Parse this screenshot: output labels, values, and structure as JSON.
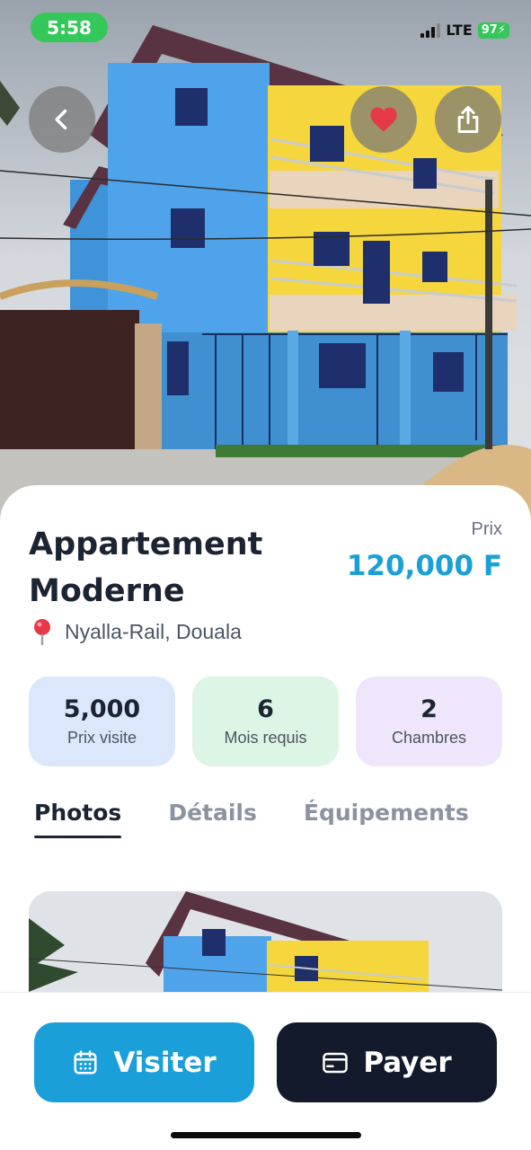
{
  "status_bar": {
    "time": "5:58",
    "network": "LTE",
    "battery": "97"
  },
  "hero": {
    "back_icon": "chevron-left-icon",
    "favorite_icon": "heart-icon",
    "share_icon": "share-icon",
    "favorite_color": "#e53945"
  },
  "listing": {
    "title_line1": "Appartement",
    "title_line2": "Moderne",
    "price_label": "Prix",
    "price_value": "120,000 F",
    "location_icon": "map-pin-icon",
    "location": "Nyalla-Rail, Douala"
  },
  "stats": [
    {
      "value": "5,000",
      "label": "Prix visite",
      "color": "#dbe8fb"
    },
    {
      "value": "6",
      "label": "Mois requis",
      "color": "#dcf5e4"
    },
    {
      "value": "2",
      "label": "Chambres",
      "color": "#efe6fb"
    }
  ],
  "tabs": [
    {
      "label": "Photos",
      "active": true
    },
    {
      "label": "Détails",
      "active": false
    },
    {
      "label": "Équipements",
      "active": false
    }
  ],
  "actions": {
    "visit_label": "Visiter",
    "visit_icon": "calendar-icon",
    "pay_label": "Payer",
    "pay_icon": "credit-card-icon"
  },
  "colors": {
    "accent": "#1a9fd8",
    "dark": "#121a2b",
    "status_green": "#34c759"
  }
}
